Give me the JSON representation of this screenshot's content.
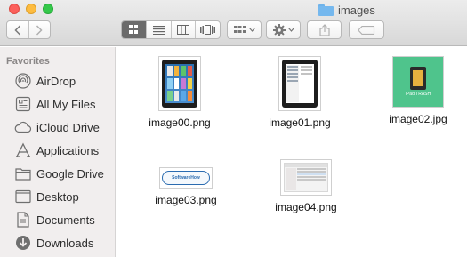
{
  "window": {
    "title": "images"
  },
  "toolbar": {
    "back_icon": "chevron-left-icon",
    "forward_icon": "chevron-right-icon",
    "view_modes": [
      "icon-view",
      "list-view",
      "column-view",
      "cover-flow-view"
    ],
    "active_view": "icon-view",
    "arrange_icon": "grid-arrange-icon",
    "action_icon": "gear-icon",
    "share_icon": "share-icon",
    "tag_icon": "tag-icon"
  },
  "sidebar": {
    "heading": "Favorites",
    "items": [
      {
        "label": "AirDrop",
        "icon": "airdrop-icon"
      },
      {
        "label": "All My Files",
        "icon": "all-files-icon"
      },
      {
        "label": "iCloud Drive",
        "icon": "cloud-icon"
      },
      {
        "label": "Applications",
        "icon": "applications-icon"
      },
      {
        "label": "Google Drive",
        "icon": "folder-icon"
      },
      {
        "label": "Desktop",
        "icon": "desktop-icon"
      },
      {
        "label": "Documents",
        "icon": "documents-icon"
      },
      {
        "label": "Downloads",
        "icon": "downloads-icon"
      }
    ]
  },
  "files": [
    {
      "name": "image00.png",
      "thumb_text": ""
    },
    {
      "name": "image01.png",
      "thumb_text": ""
    },
    {
      "name": "image02.jpg",
      "thumb_text": "iPad TRASH"
    },
    {
      "name": "image03.png",
      "thumb_text": "SoftwareHow"
    },
    {
      "name": "image04.png",
      "thumb_text": ""
    }
  ],
  "colors": {
    "accent": "#5aa2e8",
    "sidebar_bg": "#f1eeee",
    "folder_blue": "#75b8ee",
    "green_thumb": "#4fc48c"
  }
}
